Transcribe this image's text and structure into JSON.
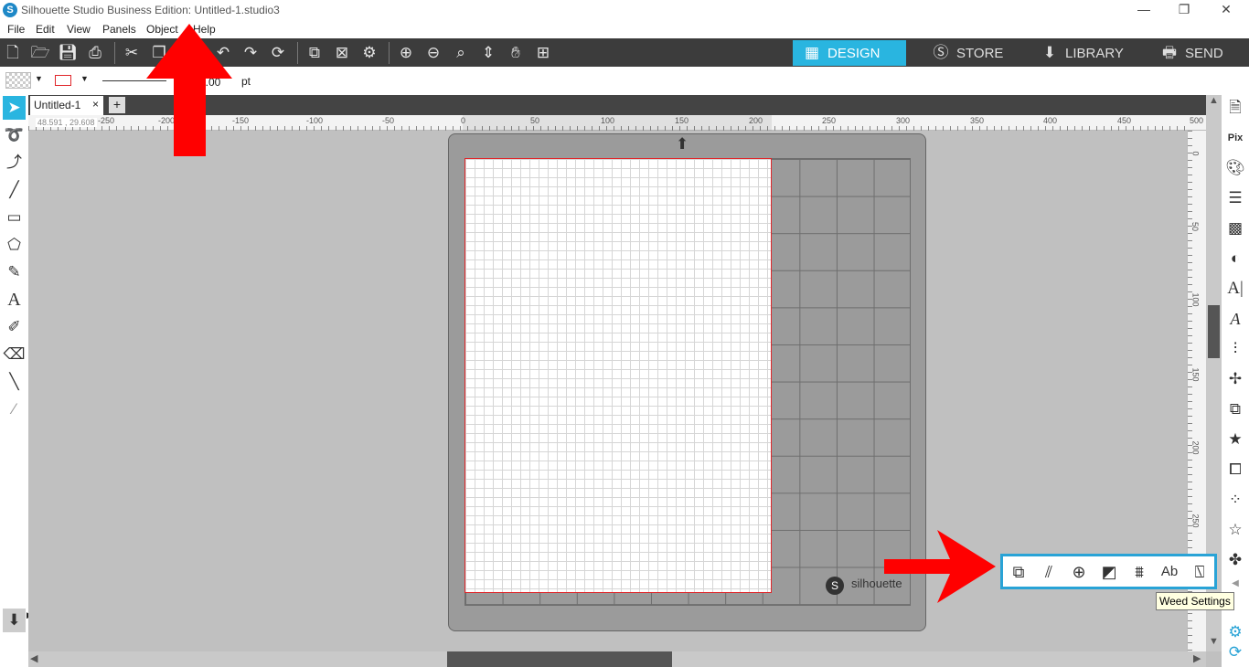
{
  "window": {
    "title": "Silhouette Studio Business Edition: Untitled-1.studio3",
    "logo": "S",
    "minimize": "—",
    "maximize": "❐",
    "close": "✕"
  },
  "menu": [
    "File",
    "Edit",
    "View",
    "Panels",
    "Object",
    "Help"
  ],
  "toolbar": {
    "icons": [
      "new-document-icon",
      "open-folder-icon",
      "save-icon",
      "print-icon",
      "cut-icon",
      "copy-icon",
      "paste-icon",
      "undo-icon",
      "redo-icon",
      "redraw-icon",
      "group-icon",
      "ungroup-icon",
      "compound-icon",
      "zoom-in-icon",
      "zoom-out-icon",
      "zoom-fit-icon",
      "move-page-icon",
      "pan-hand-icon",
      "fit-page-icon"
    ],
    "tabs": [
      {
        "label": "DESIGN",
        "icon": "grid-icon",
        "active": true
      },
      {
        "label": "STORE",
        "icon": "store-s-icon",
        "active": false
      },
      {
        "label": "LIBRARY",
        "icon": "library-icon",
        "active": false
      },
      {
        "label": "SEND",
        "icon": "send-cutter-icon",
        "active": false
      }
    ],
    "active_color": "#29b5e0"
  },
  "properties": {
    "line_width": "0.00",
    "unit": "pt",
    "line_color": "#e0262a"
  },
  "document": {
    "tab_label": "Untitled-1",
    "close": "×",
    "new": "+",
    "coordinates": "48.591 , 29.608"
  },
  "ruler": {
    "h_ticks": [
      "-250",
      "-200",
      "-150",
      "-100",
      "-50",
      "0",
      "50",
      "100",
      "150",
      "200",
      "250",
      "300",
      "350",
      "400",
      "450",
      "500"
    ],
    "v_ticks": [
      "0",
      "50",
      "100",
      "150",
      "200",
      "250"
    ]
  },
  "mat": {
    "brand": "silhouette",
    "logo": "S"
  },
  "floating_toolbar": {
    "icons": [
      "layers-icon",
      "hatch-icon",
      "globe-grid-icon",
      "offset-icon",
      "warp-icon",
      "text-ab-icon",
      "weed-icon"
    ]
  },
  "tooltip": "Weed Settings",
  "accent_color": "#29a3d6"
}
